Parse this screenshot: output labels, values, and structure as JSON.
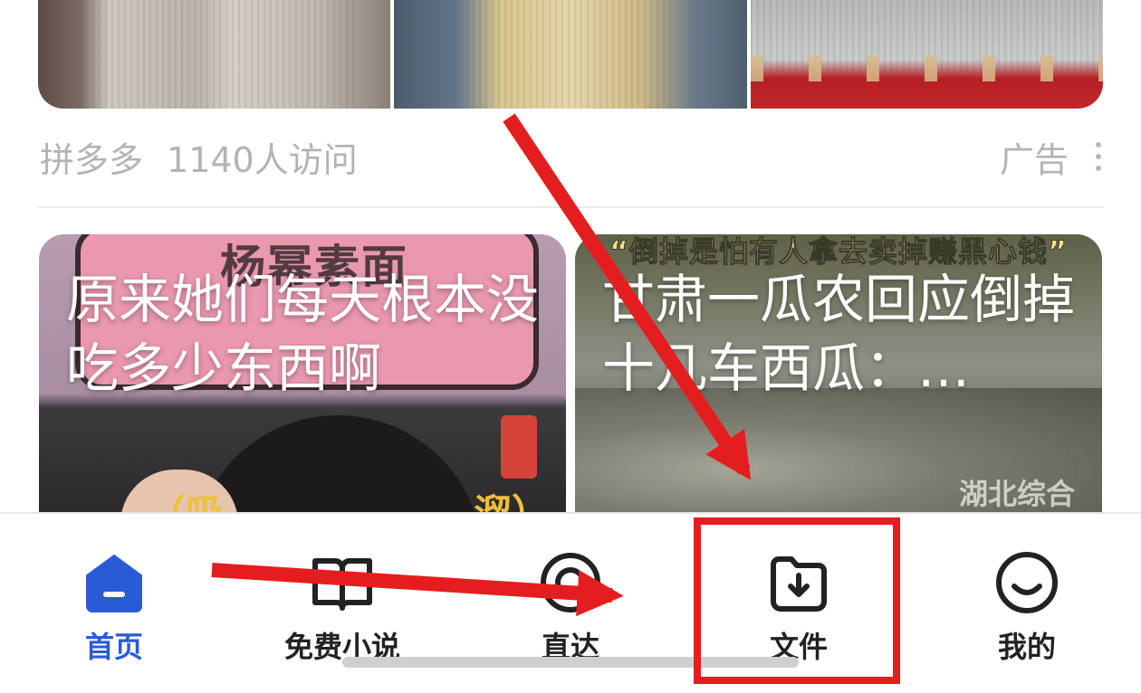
{
  "ad": {
    "source": "拼多多",
    "visits": "1140人访问",
    "label": "广告"
  },
  "feed": [
    {
      "title": "原来她们每天根本没吃多少东西啊",
      "bg_text": "杨幂素面",
      "caption_left": "（吸",
      "caption_right": "溜）"
    },
    {
      "title": "甘肃一瓜农回应倒掉十几车西瓜：…",
      "banner": "“倒掉是怕有人拿去卖掉赚黑心钱”",
      "watermark": "湖北综合"
    }
  ],
  "nav": {
    "items": [
      {
        "label": "首页",
        "icon": "home-icon",
        "active": true
      },
      {
        "label": "免费小说",
        "icon": "book-icon",
        "active": false
      },
      {
        "label": "直达",
        "icon": "search-icon",
        "active": false
      },
      {
        "label": "文件",
        "icon": "folder-download-icon",
        "active": false
      },
      {
        "label": "我的",
        "icon": "smile-icon",
        "active": false
      }
    ]
  },
  "colors": {
    "accent": "#2a5bd7",
    "annotation": "#e41e1e",
    "meta_text": "#b3b3b3"
  }
}
